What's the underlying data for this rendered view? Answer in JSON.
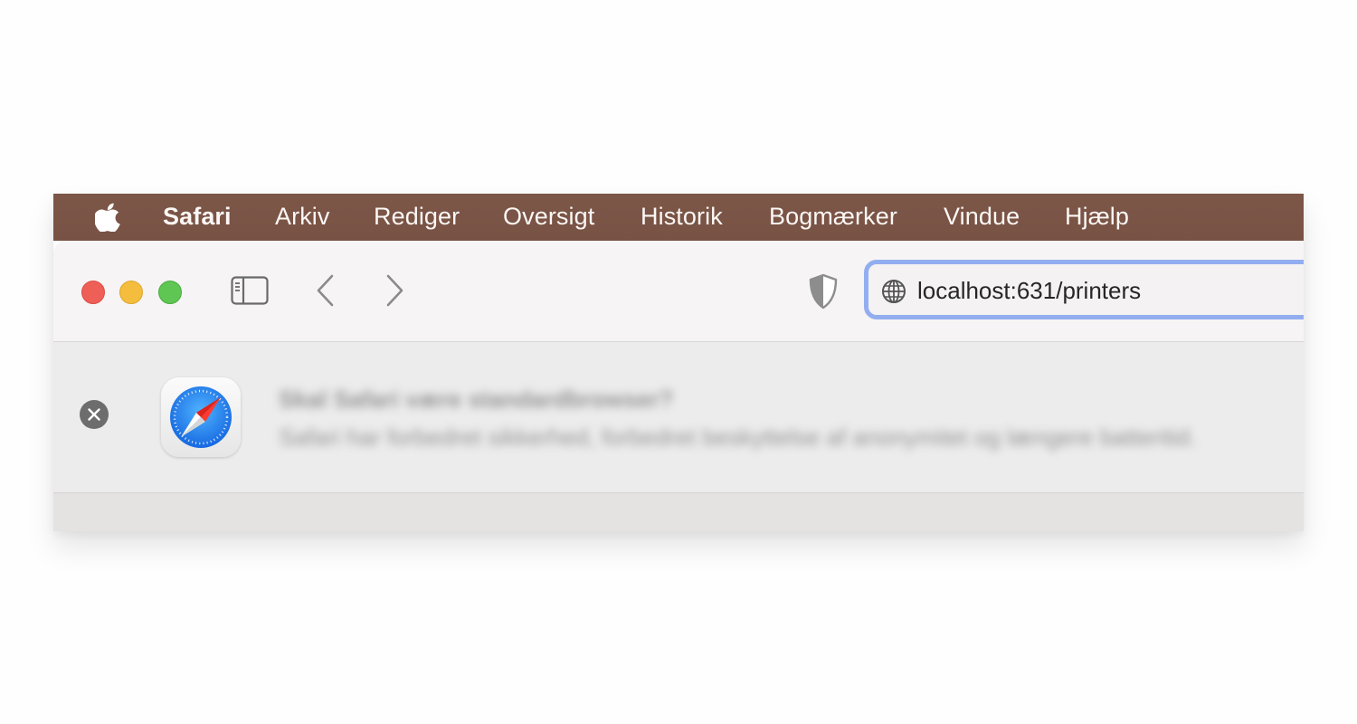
{
  "menubar": {
    "items": [
      {
        "label": "Safari"
      },
      {
        "label": "Arkiv"
      },
      {
        "label": "Rediger"
      },
      {
        "label": "Oversigt"
      },
      {
        "label": "Historik"
      },
      {
        "label": "Bogmærker"
      },
      {
        "label": "Vindue"
      },
      {
        "label": "Hjælp"
      }
    ]
  },
  "toolbar": {
    "address_url": "localhost:631/printers"
  },
  "icons": {
    "apple": "apple-logo-icon",
    "sidebar": "sidebar-icon",
    "back": "chevron-left-icon",
    "forward": "chevron-right-icon",
    "privacy": "shield-icon",
    "globe": "globe-icon",
    "close": "close-icon",
    "app": "safari-compass-icon"
  },
  "colors": {
    "menubar": "#7a5445",
    "close_light": "#ee5f58",
    "minimize_light": "#f5bd3d",
    "zoom_light": "#5fc553",
    "address_focus": "#93aef0"
  },
  "banner": {
    "title": "Skal Safari være standardbrowser?",
    "body": "Safari har forbedret sikkerhed, forbedret beskyttelse af anonymitet og længere batteritid."
  }
}
